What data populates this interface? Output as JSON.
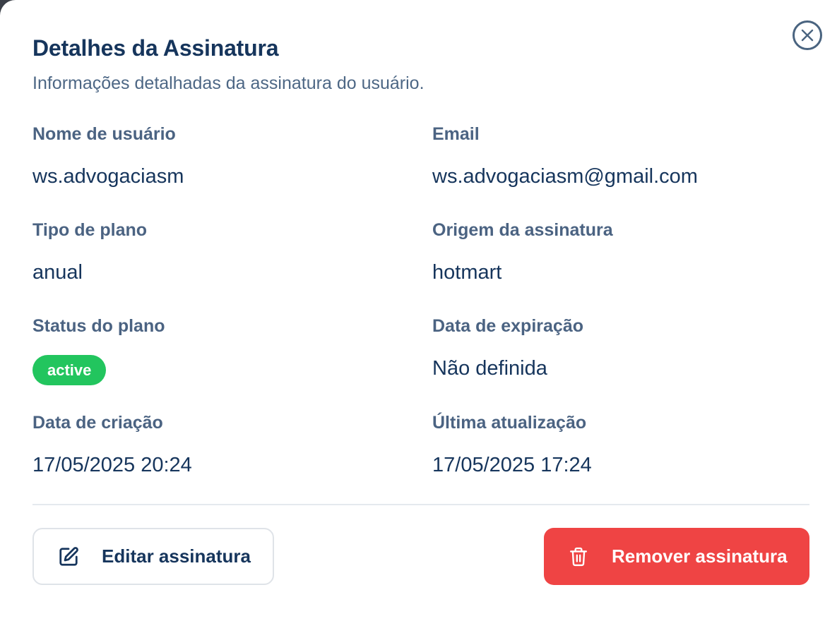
{
  "dialog": {
    "title": "Detalhes da Assinatura",
    "subtitle": "Informações detalhadas da assinatura do usuário.",
    "close_icon": "close-icon"
  },
  "fields": {
    "username": {
      "label": "Nome de usuário",
      "value": "ws.advogaciasm"
    },
    "email": {
      "label": "Email",
      "value": "ws.advogaciasm@gmail.com"
    },
    "plan_type": {
      "label": "Tipo de plano",
      "value": "anual"
    },
    "origin": {
      "label": "Origem da assinatura",
      "value": "hotmart"
    },
    "status": {
      "label": "Status do plano",
      "value": "active",
      "color": "#22c55e"
    },
    "expiration": {
      "label": "Data de expiração",
      "value": "Não definida"
    },
    "created": {
      "label": "Data de criação",
      "value": "17/05/2025 20:24"
    },
    "updated": {
      "label": "Última atualização",
      "value": "17/05/2025 17:24"
    }
  },
  "actions": {
    "edit": {
      "label": "Editar assinatura",
      "icon": "edit-icon"
    },
    "remove": {
      "label": "Remover assinatura",
      "icon": "trash-icon",
      "color": "#ef4444"
    }
  },
  "colors": {
    "heading": "#16355c",
    "label": "#4b6382",
    "accent_success": "#22c55e",
    "accent_danger": "#ef4444"
  }
}
